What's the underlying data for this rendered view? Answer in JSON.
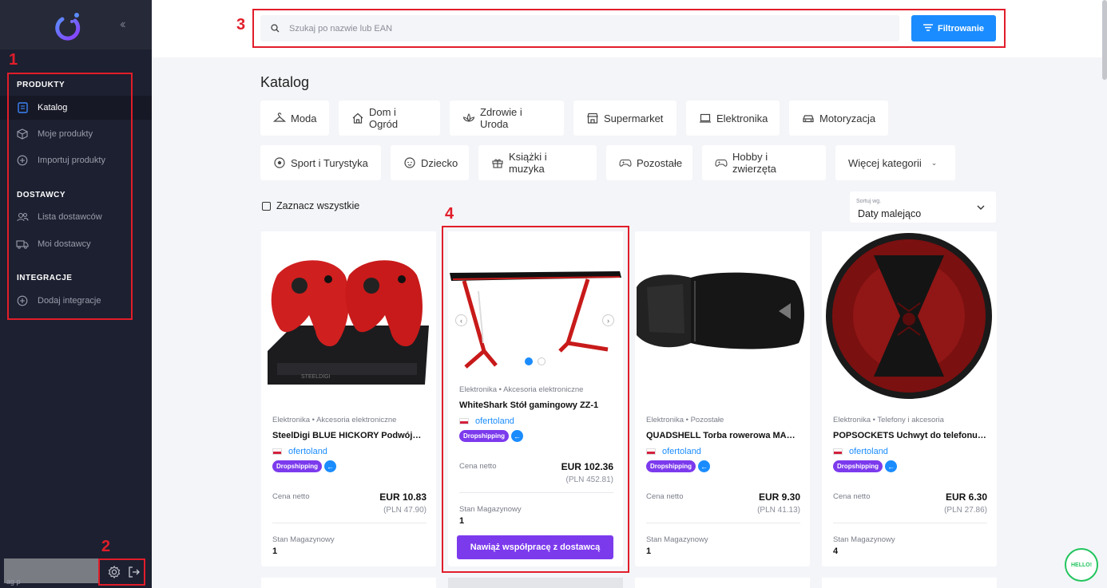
{
  "sidebar": {
    "sections": [
      {
        "title": "PRODUKTY"
      },
      {
        "title": "DOSTAWCY"
      },
      {
        "title": "INTEGRACJE"
      }
    ],
    "items": [
      {
        "label": "Katalog",
        "icon": "catalog-icon"
      },
      {
        "label": "Moje produkty",
        "icon": "box-icon"
      },
      {
        "label": "Importuj produkty",
        "icon": "plus-circle-icon"
      },
      {
        "label": "Lista dostawców",
        "icon": "users-icon"
      },
      {
        "label": "Moi dostawcy",
        "icon": "truck-icon"
      },
      {
        "label": "Dodaj integracje",
        "icon": "plus-circle-icon"
      }
    ],
    "user_text": "ag      p"
  },
  "search": {
    "placeholder": "Szukaj po nazwie lub EAN",
    "filter_label": "Filtrowanie"
  },
  "main": {
    "title": "Katalog",
    "categories_row1": [
      "Moda",
      "Dom i Ogród",
      "Zdrowie i Uroda",
      "Supermarket",
      "Elektronika",
      "Motoryzacja"
    ],
    "categories_row2": [
      "Sport i Turystyka",
      "Dziecko",
      "Książki i muzyka",
      "Pozostałe",
      "Hobby i zwierzęta",
      "Więcej kategorii"
    ],
    "select_all": "Zaznacz wszystkie",
    "sort_label": "Sortuj wg.",
    "sort_value": "Daty malejąco"
  },
  "products": [
    {
      "category": "Elektronika • Akcesoria elektroniczne",
      "title": "SteelDigi BLUE HICKORY Podwójna stacja",
      "supplier": "ofertoland",
      "badge": "Dropshipping",
      "price_label": "Cena netto",
      "price": "EUR 10.83",
      "price_pln": "(PLN 47.90)",
      "stock_label": "Stan Magazynowy",
      "stock": "1"
    },
    {
      "category": "Elektronika • Akcesoria elektroniczne",
      "title": "WhiteShark Stół gamingowy ZZ-1",
      "supplier": "ofertoland",
      "badge": "Dropshipping",
      "price_label": "Cena netto",
      "price": "EUR 102.36",
      "price_pln": "(PLN 452.81)",
      "stock_label": "Stan Magazynowy",
      "stock": "1",
      "cta": "Nawiąż współpracę z dostawcą"
    },
    {
      "category": "Elektronika • Pozostałe",
      "title": "QUADSHELL Torba rowerowa MAGNETIC",
      "supplier": "ofertoland",
      "badge": "Dropshipping",
      "price_label": "Cena netto",
      "price": "EUR 9.30",
      "price_pln": "(PLN 41.13)",
      "stock_label": "Stan Magazynowy",
      "stock": "1"
    },
    {
      "category": "Elektronika • Telefony i akcesoria",
      "title": "POPSOCKETS Uchwyt do telefonu Black Widow",
      "supplier": "ofertoland",
      "badge": "Dropshipping",
      "price_label": "Cena netto",
      "price": "EUR 6.30",
      "price_pln": "(PLN 27.86)",
      "stock_label": "Stan Magazynowy",
      "stock": "4"
    }
  ],
  "annotations": [
    "1",
    "2",
    "3",
    "4"
  ],
  "chat_label": "HELLO!",
  "colors": {
    "accent": "#1a8cff",
    "purple": "#7c3aed",
    "annotation": "#e11d2a",
    "sidebar": "#1d2030"
  }
}
